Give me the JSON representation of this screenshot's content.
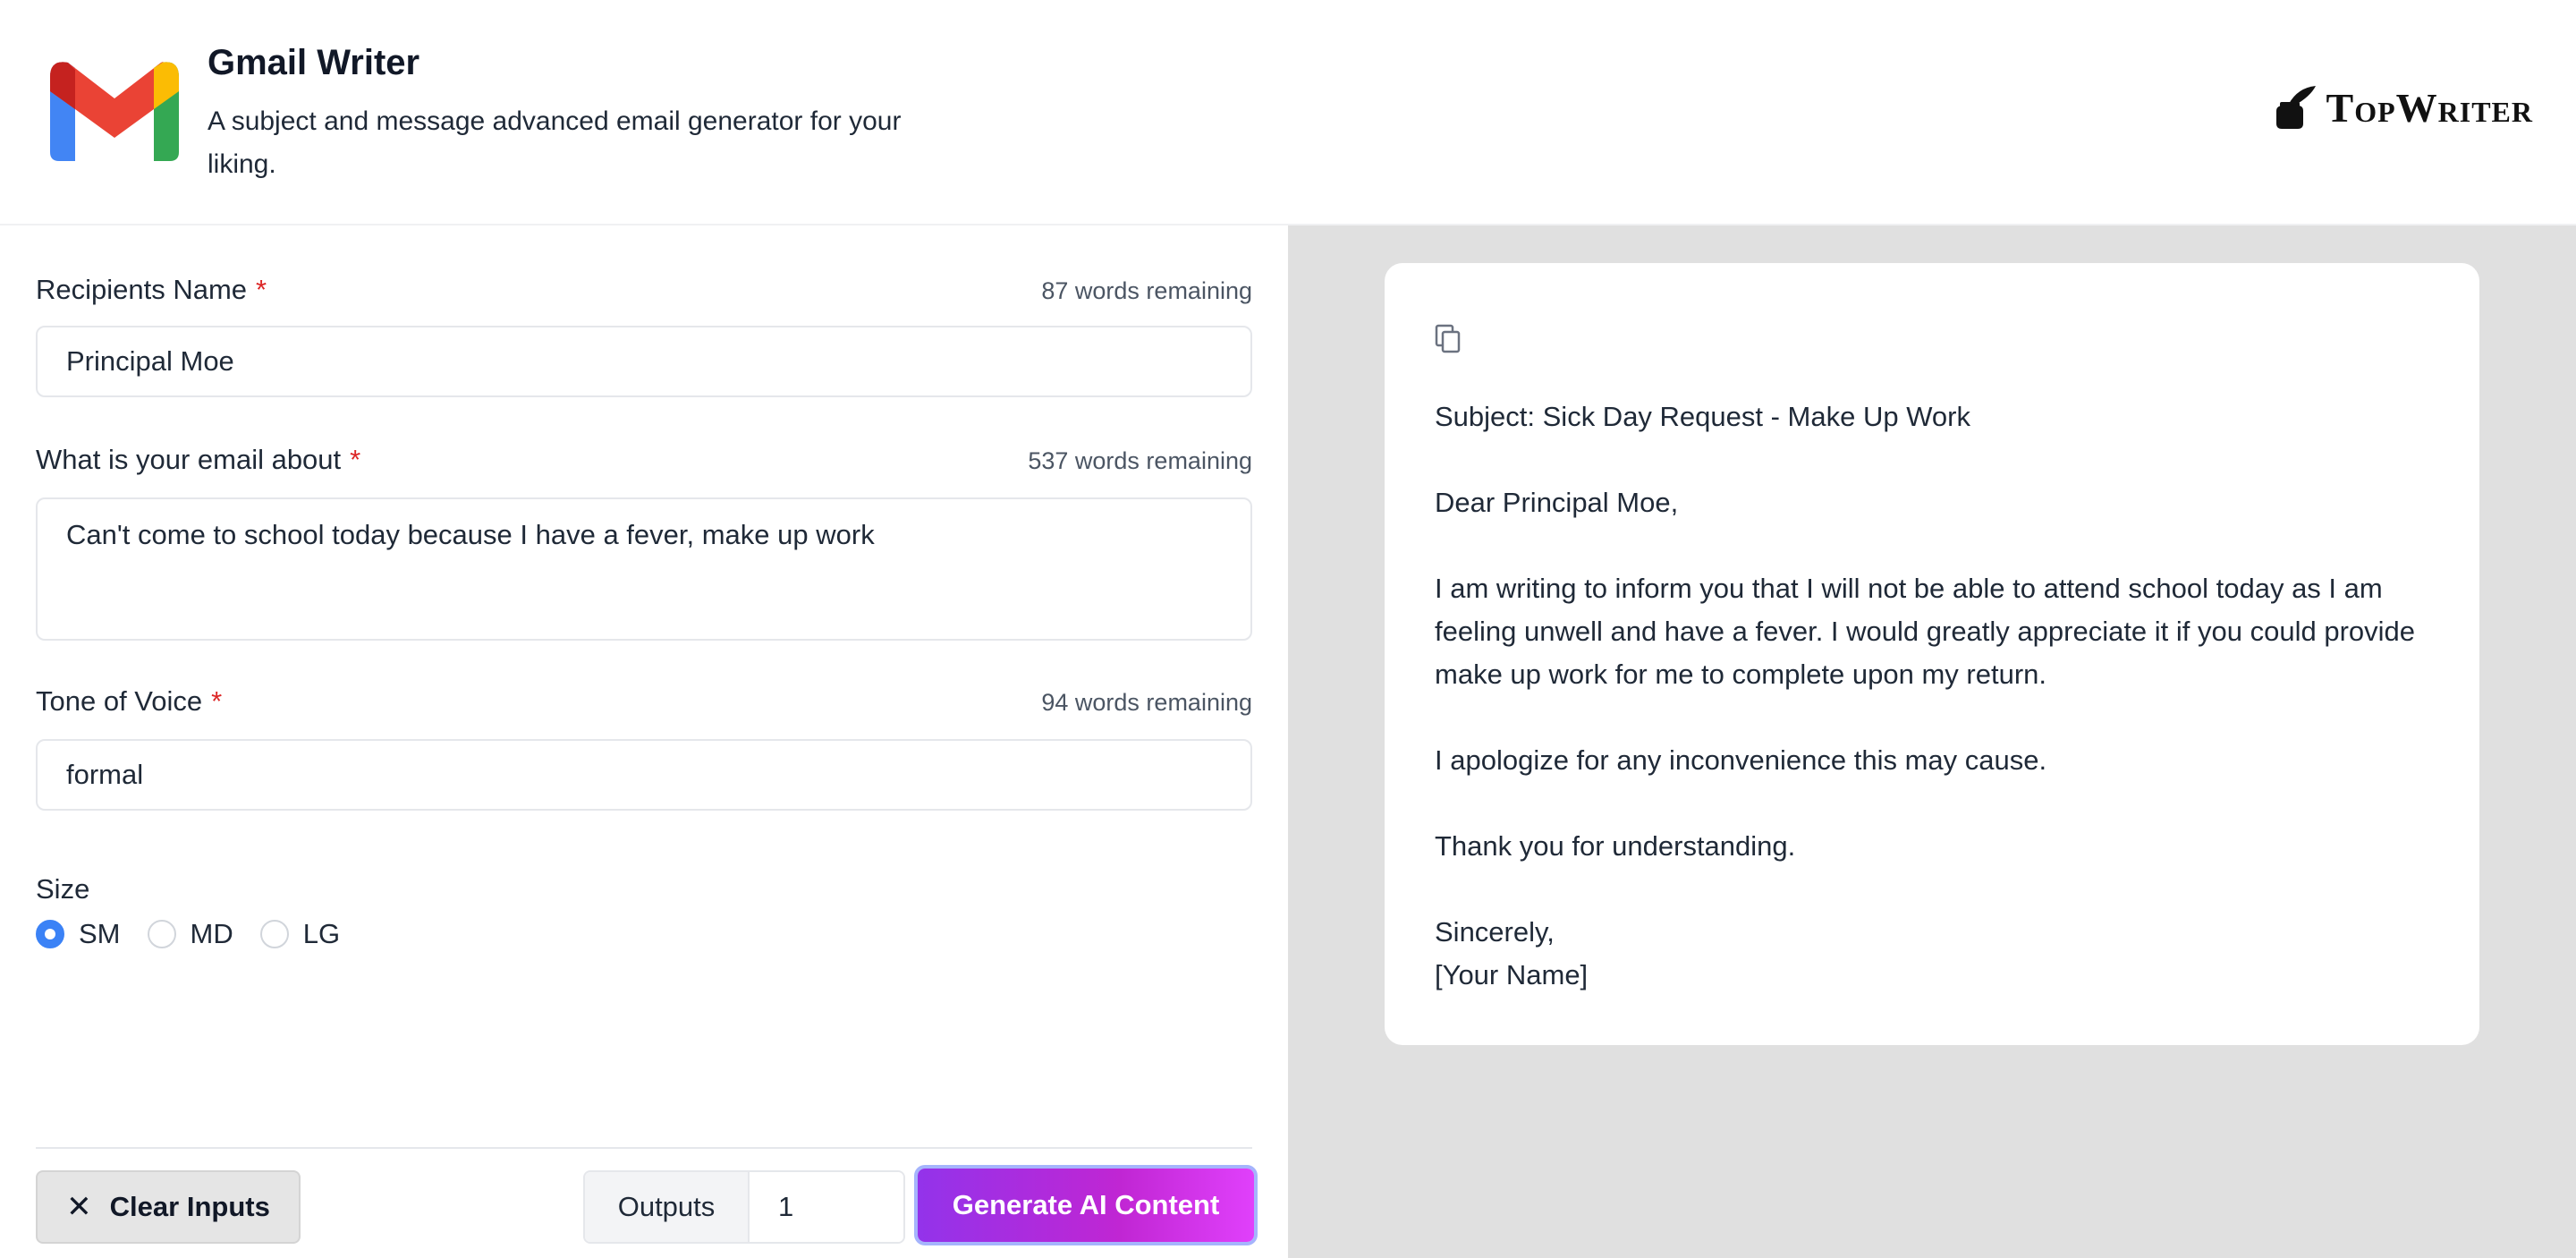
{
  "header": {
    "title": "Gmail Writer",
    "description": "A subject and message advanced email generator for your liking.",
    "brand": "TopWriter"
  },
  "form": {
    "recipient": {
      "label": "Recipients Name",
      "required": "*",
      "remaining": "87 words remaining",
      "value": "Principal Moe"
    },
    "about": {
      "label": "What is your email about",
      "required": "*",
      "remaining": "537 words remaining",
      "value": "Can't come to school today because I have a fever, make up work"
    },
    "tone": {
      "label": "Tone of Voice",
      "required": "*",
      "remaining": "94 words remaining",
      "value": "formal"
    },
    "size": {
      "label": "Size",
      "options": [
        "SM",
        "MD",
        "LG"
      ],
      "selected": "SM"
    }
  },
  "actions": {
    "clear_label": "Clear Inputs",
    "outputs_label": "Outputs",
    "outputs_value": "1",
    "generate_label": "Generate AI Content"
  },
  "output": {
    "subject": "Subject: Sick Day Request - Make Up Work",
    "greeting": "Dear Principal Moe,",
    "body1": "I am writing to inform you that I will not be able to attend school today as I am feeling unwell and have a fever. I would greatly appreciate it if you could provide make up work for me to complete upon my return.",
    "body2": "I apologize for any inconvenience this may cause.",
    "body3": "Thank you for understanding.",
    "closing": "Sincerely,",
    "signature": "[Your Name]"
  },
  "colors": {
    "accent_start": "#9333ea",
    "accent_end": "#e040fb",
    "radio_selected": "#3b82f6",
    "required": "#dc2626",
    "panel_bg": "#e0e0e0"
  }
}
